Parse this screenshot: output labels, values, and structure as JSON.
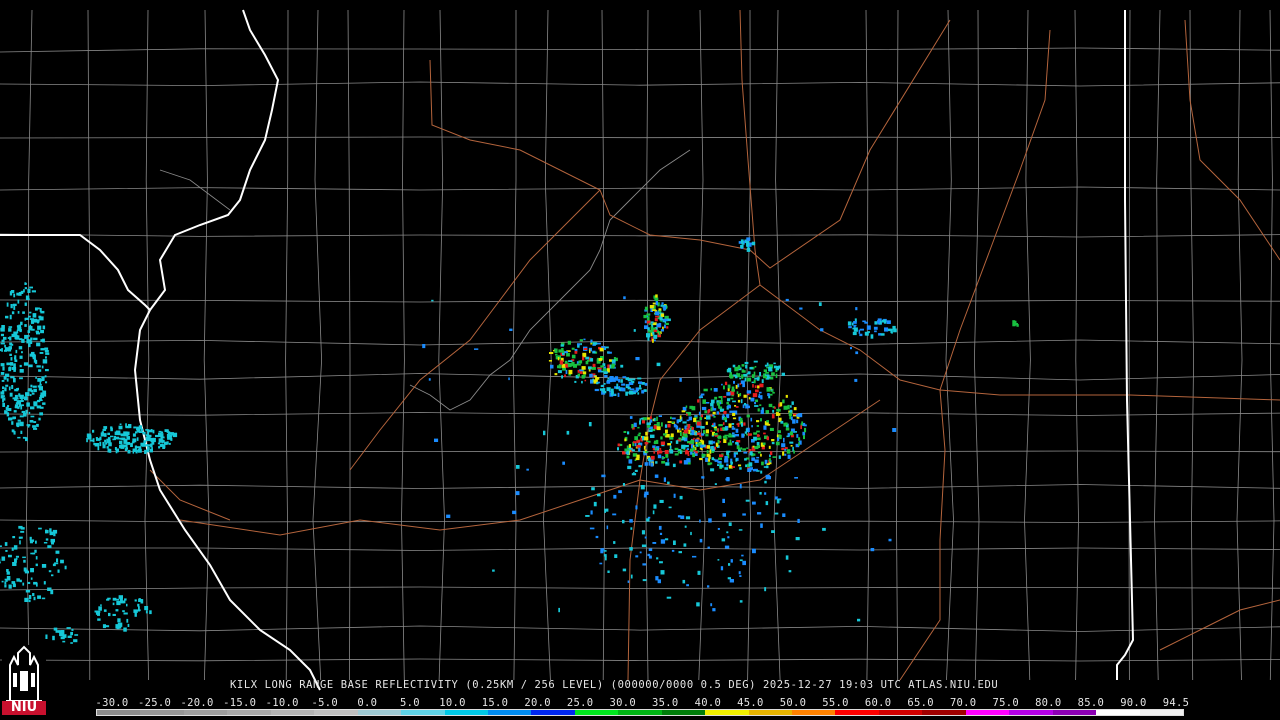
{
  "product": {
    "caption": "KILX LONG RANGE BASE REFLECTIVITY (0.25KM / 256 LEVEL) (000000/0000 0.5 DEG) 2025-12-27 19:03 UTC  ATLAS.NIU.EDU"
  },
  "colorbar": {
    "labels": [
      "-30.0",
      "-25.0",
      "-20.0",
      "-15.0",
      "-10.0",
      "-5.0",
      "0.0",
      "5.0",
      "10.0",
      "15.0",
      "20.0",
      "25.0",
      "30.0",
      "35.0",
      "40.0",
      "45.0",
      "50.0",
      "55.0",
      "60.0",
      "65.0",
      "70.0",
      "75.0",
      "80.0",
      "85.0",
      "90.0",
      "94.5"
    ],
    "colors": [
      "#8c8c8c",
      "#959595",
      "#9e9e9e",
      "#a8a8a8",
      "#b3b3b3",
      "#bfbfbf",
      "#9ec9d3",
      "#5fd3e6",
      "#00c8e6",
      "#008cf0",
      "#0028f0",
      "#00e61e",
      "#00b414",
      "#007d0a",
      "#f0f000",
      "#e6b400",
      "#ff8200",
      "#ff0000",
      "#d20000",
      "#a00000",
      "#ff00ff",
      "#b400e6",
      "#8c00b4",
      "#ffffff",
      "#f0f0f0"
    ]
  },
  "logo": {
    "text": "NIU"
  },
  "map_style": {
    "background": "#000000",
    "county_line_color": "#8a8a8a",
    "state_line_color": "#ffffff",
    "road_color": "#b4643c",
    "echo_light": "#16c8d8",
    "echo_mid": "#1a8cff",
    "echo_green": "#18c040",
    "echo_yellow": "#e6e600",
    "echo_red": "#e61e1e"
  }
}
